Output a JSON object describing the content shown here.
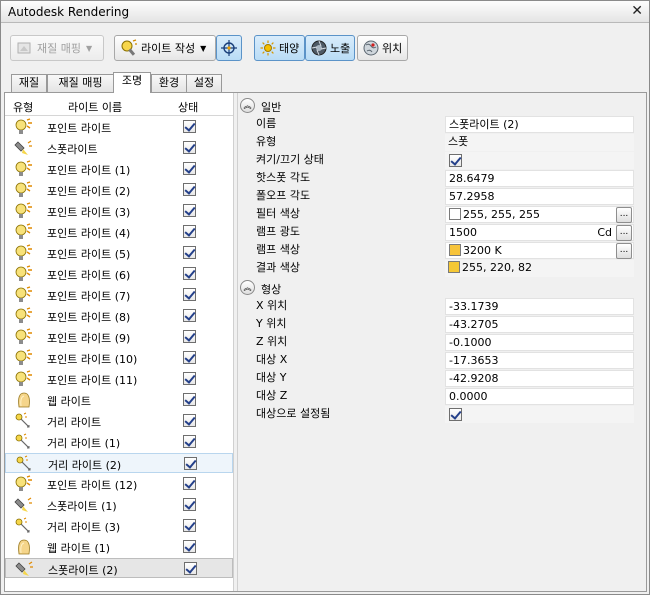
{
  "window": {
    "title": "Autodesk Rendering"
  },
  "toolbar": {
    "material_map": "재질 매핑",
    "create_light": "라이트 작성",
    "sun": "태양",
    "exposure": "노출",
    "location": "위치"
  },
  "tabs": [
    "재질",
    "재질 매핑",
    "조명",
    "환경",
    "설정"
  ],
  "active_tab": "조명",
  "list": {
    "headers": {
      "type": "유형",
      "name": "라이트 이름",
      "status": "상태"
    },
    "items": [
      {
        "name": "포인트 라이트",
        "type": "point",
        "on": true
      },
      {
        "name": "스폿라이트",
        "type": "spot",
        "on": true
      },
      {
        "name": "포인트 라이트 (1)",
        "type": "point",
        "on": true
      },
      {
        "name": "포인트 라이트 (2)",
        "type": "point",
        "on": true
      },
      {
        "name": "포인트 라이트 (3)",
        "type": "point",
        "on": true
      },
      {
        "name": "포인트 라이트 (4)",
        "type": "point",
        "on": true
      },
      {
        "name": "포인트 라이트 (5)",
        "type": "point",
        "on": true
      },
      {
        "name": "포인트 라이트 (6)",
        "type": "point",
        "on": true
      },
      {
        "name": "포인트 라이트 (7)",
        "type": "point",
        "on": true
      },
      {
        "name": "포인트 라이트 (8)",
        "type": "point",
        "on": true
      },
      {
        "name": "포인트 라이트 (9)",
        "type": "point",
        "on": true
      },
      {
        "name": "포인트 라이트 (10)",
        "type": "point",
        "on": true
      },
      {
        "name": "포인트 라이트 (11)",
        "type": "point",
        "on": true
      },
      {
        "name": "웹 라이트",
        "type": "web",
        "on": true
      },
      {
        "name": "거리 라이트",
        "type": "distant",
        "on": true
      },
      {
        "name": "거리 라이트 (1)",
        "type": "distant",
        "on": true
      },
      {
        "name": "거리 라이트 (2)",
        "type": "distant",
        "on": true,
        "state": "hover"
      },
      {
        "name": "포인트 라이트 (12)",
        "type": "point",
        "on": true
      },
      {
        "name": "스폿라이트 (1)",
        "type": "spot",
        "on": true
      },
      {
        "name": "거리 라이트 (3)",
        "type": "distant",
        "on": true
      },
      {
        "name": "웹 라이트 (1)",
        "type": "web",
        "on": true
      },
      {
        "name": "스폿라이트 (2)",
        "type": "spot",
        "on": true,
        "state": "selected"
      }
    ]
  },
  "general": {
    "title": "일반",
    "rows": [
      {
        "label": "이름",
        "value": "스폿라이트 (2)",
        "kind": "edit"
      },
      {
        "label": "유형",
        "value": "스폿",
        "kind": "ro"
      },
      {
        "label": "켜기/끄기 상태",
        "value": "",
        "kind": "check",
        "checked": true
      },
      {
        "label": "핫스폿 각도",
        "value": "28.6479",
        "kind": "edit"
      },
      {
        "label": "폴오프 각도",
        "value": "57.2958",
        "kind": "edit"
      },
      {
        "label": "필터 색상",
        "value": "255, 255, 255",
        "kind": "color",
        "color": "#ffffff",
        "button": "..."
      },
      {
        "label": "램프 광도",
        "value": "1500",
        "kind": "unit",
        "unit": "Cd",
        "button": "..."
      },
      {
        "label": "램프 색상",
        "value": "3200 K",
        "kind": "color",
        "color": "#f7c43a",
        "button": "..."
      },
      {
        "label": "결과 색상",
        "value": "255, 220, 82",
        "kind": "color-ro",
        "color": "#f5c836"
      }
    ]
  },
  "geometry": {
    "title": "형상",
    "rows": [
      {
        "label": "X 위치",
        "value": "-33.1739",
        "kind": "edit"
      },
      {
        "label": "Y 위치",
        "value": "-43.2705",
        "kind": "edit"
      },
      {
        "label": "Z 위치",
        "value": "-0.1000",
        "kind": "edit"
      },
      {
        "label": "대상 X",
        "value": "-17.3653",
        "kind": "edit"
      },
      {
        "label": "대상 Y",
        "value": "-42.9208",
        "kind": "edit"
      },
      {
        "label": "대상 Z",
        "value": "0.0000",
        "kind": "edit"
      },
      {
        "label": "대상으로 설정됨",
        "value": "",
        "kind": "check",
        "checked": true
      }
    ]
  }
}
